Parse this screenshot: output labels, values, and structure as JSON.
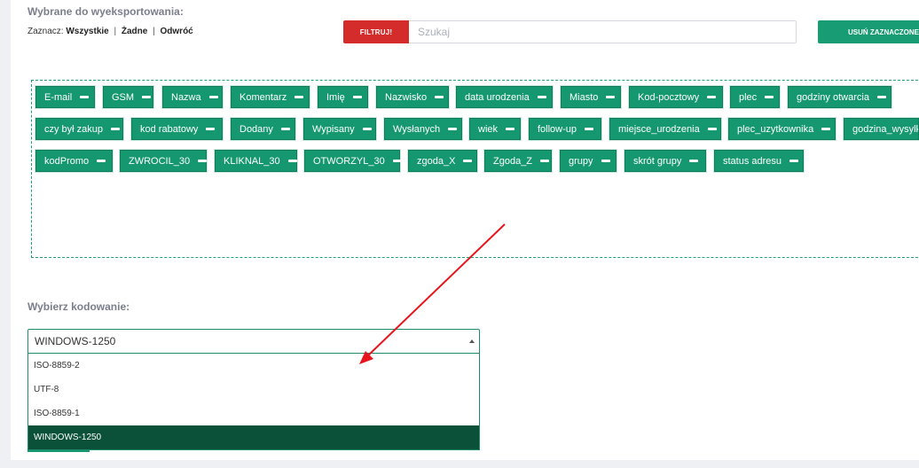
{
  "export": {
    "title": "Wybrane do wyeksportowania:",
    "select_prefix": "Zaznacz:",
    "select_all": "Wszystkie",
    "select_none": "Żadne",
    "select_invert": "Odwróć",
    "sep": "|"
  },
  "filter": {
    "button_label": "FILTRUJ!",
    "search_placeholder": "Szukaj",
    "search_value": ""
  },
  "remove_button_label": "USUŃ ZAZNACZONE",
  "fields": [
    "E-mail",
    "GSM",
    "Nazwa",
    "Komentarz",
    "Imię",
    "Nazwisko",
    "data urodzenia",
    "Miasto",
    "Kod-pocztowy",
    "plec",
    "godziny otwarcia",
    "czy był zakup",
    "kod rabatowy",
    "Dodany",
    "Wypisany",
    "Wysłanych",
    "wiek",
    "follow-up",
    "miejsce_urodzenia",
    "plec_uzytkownika",
    "godzina_wysylki",
    "kodPromo",
    "ZWROCIL_30",
    "KLIKNAL_30",
    "OTWORZYL_30",
    "zgoda_X",
    "Zgoda_Z",
    "grupy",
    "skrót grupy",
    "status adresu"
  ],
  "encoding": {
    "title": "Wybierz kodowanie:",
    "selected": "WINDOWS-1250",
    "options": [
      "ISO-8859-2",
      "UTF-8",
      "ISO-8859-1",
      "WINDOWS-1250"
    ]
  },
  "colors": {
    "accent_green": "#179c74",
    "danger_red": "#d42b2b",
    "selected_dark": "#0b5139",
    "arrow_red": "#e8141b"
  }
}
